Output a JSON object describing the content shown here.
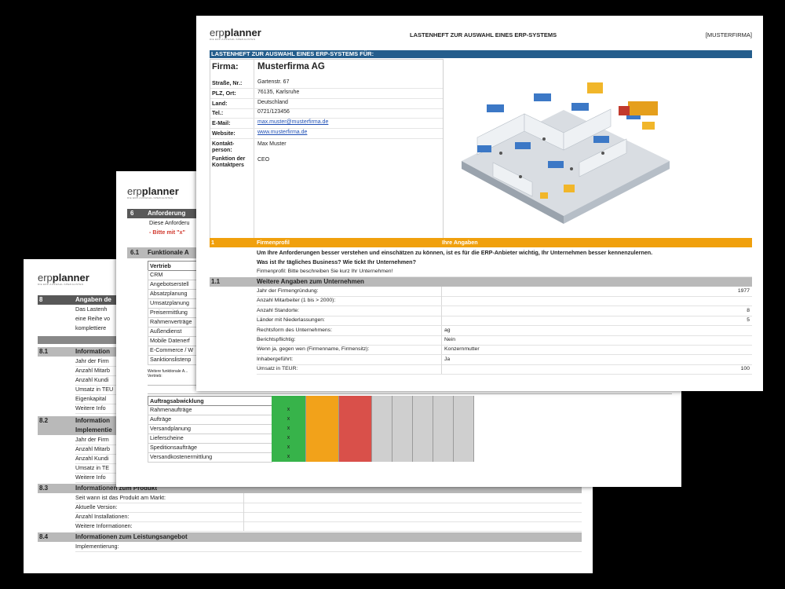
{
  "logo": {
    "erp": "erp",
    "planner": "planner",
    "tagline": "DIE ERP-AUSWAHL-SPEZIALISTEN"
  },
  "sheet3": {
    "s8": {
      "num": "8",
      "title": "Angaben de"
    },
    "s8_text": [
      "Das Lastenh",
      "eine Reihe vo",
      "komplettiere"
    ],
    "s81": {
      "num": "8.1",
      "title": "Information"
    },
    "s81_items": [
      "Jahr der Firm",
      "Anzahl Mitarb",
      "Anzahl Kundi",
      "Umsatz in TEU",
      "Eigenkapital",
      "Weitere Info"
    ],
    "s82": {
      "num": "8.2",
      "title": "Information",
      "title2": "Implementie"
    },
    "s82_items": [
      "Jahr der Firm",
      "Anzahl Mitarb",
      "Anzahl Kundi",
      "Umsatz in TE",
      "Weitere Info"
    ],
    "s83": {
      "num": "8.3",
      "title": "Informationen zum Produkt"
    },
    "s83_items": [
      "Seit wann ist das Produkt am Markt:",
      "Aktuelle Version:",
      "Anzahl Installationen:",
      "Weitere Informationen:"
    ],
    "s84": {
      "num": "8.4",
      "title": "Informationen zum Leistungsangebot"
    },
    "s84_items": [
      "Implementierung:"
    ]
  },
  "sheet2": {
    "s6": {
      "num": "6",
      "title": "Anforderung"
    },
    "s6_text": "Diese Anforderu",
    "s6_hint": "- Bitte mit \"x\"",
    "s61": {
      "num": "6.1",
      "title": "Funktionale A"
    },
    "vertrieb_header": "Vertrieb",
    "vertrieb_items": [
      "CRM",
      "Angebotserstell",
      "Absatzplanung",
      "Umsatzplanung",
      "Preisermittlung",
      "Rahmenverträge",
      "Außendienst",
      "Mobile Datenerf",
      "E-Commerce / W",
      "Sanktionslistenp"
    ],
    "vertrieb_note": "Weitere funktionale A... Vertrieb:",
    "auftrag_header": "Auftragsabwicklung",
    "auftrag_items": [
      "Rahmenaufträge",
      "Aufträge",
      "Versandplanung",
      "Lieferscheine",
      "Speditionsaufträge",
      "Versandkostenermittlung"
    ],
    "mark": "x"
  },
  "sheet1": {
    "doc_title": "LASTENHEFT ZUR AUSWAHL EINES ERP-SYSTEMS",
    "company_tag": "[MUSTERFIRMA]",
    "band": "LASTENHEFT ZUR AUSWAHL EINES ERP-SYSTEMS FÜR:",
    "firma_label": "Firma:",
    "firma_value": "Musterfirma AG",
    "fields": [
      {
        "label": "Straße, Nr.:",
        "value": "Gartenstr. 67",
        "link": false
      },
      {
        "label": "PLZ, Ort:",
        "value": "76135, Karlsruhe",
        "link": false
      },
      {
        "label": "Land:",
        "value": "Deutschland",
        "link": false
      },
      {
        "label": "Tel.:",
        "value": "0721/123456",
        "link": false
      },
      {
        "label": "E-Mail:",
        "value": "max.muster@musterfirma.de",
        "link": true
      },
      {
        "label": "Website:",
        "value": "www.musterfirma.de",
        "link": true
      }
    ],
    "kontakt_label": [
      "Kontakt-",
      "person:"
    ],
    "kontakt_value": "Max Muster",
    "funktion_label": [
      "Funktion der",
      "Kontaktpers"
    ],
    "funktion_value": "CEO",
    "s1": {
      "num": "1",
      "title": "Firmenprofil",
      "right": "Ihre Angaben"
    },
    "s1_text": [
      "Um Ihre Anforderungen besser verstehen und einschätzen zu können, ist es für die ERP-Anbieter wichtig, Ihr Unternehmen besser kennenzulernen.",
      "Was ist Ihr tägliches Business? Wie tickt Ihr Unternehmen?"
    ],
    "s1_prompt": "Firmenprofil: Bitte beschreiben Sie kurz Ihr Unternehmen!",
    "s11": {
      "num": "1.1",
      "title": "Weitere Angaben zum Unternehmen"
    },
    "s11_rows": [
      {
        "label": "Jahr der Firmengründung:",
        "value": "1977",
        "align": "right"
      },
      {
        "label": "Anzahl Mitarbeiter (1 bis > 2000):",
        "value": "",
        "align": "right"
      },
      {
        "label": "Anzahl Standorte:",
        "value": "8",
        "align": "right"
      },
      {
        "label": "Länder mit Niederlassungen:",
        "value": "5",
        "align": "right"
      },
      {
        "label": "Rechtsform des Unternehmens:",
        "value": "ag",
        "align": "left"
      },
      {
        "label": "Berichtspflichtig:",
        "value": "Nein",
        "align": "left"
      },
      {
        "label": "Wenn ja, gegen wen (Firmenname, Firmensitz):",
        "value": "Konzernmutter",
        "align": "left"
      },
      {
        "label": "Inhabergeführt:",
        "value": "Ja",
        "align": "left"
      },
      {
        "label": "Umsatz in TEUR:",
        "value": "100",
        "align": "right"
      }
    ]
  }
}
